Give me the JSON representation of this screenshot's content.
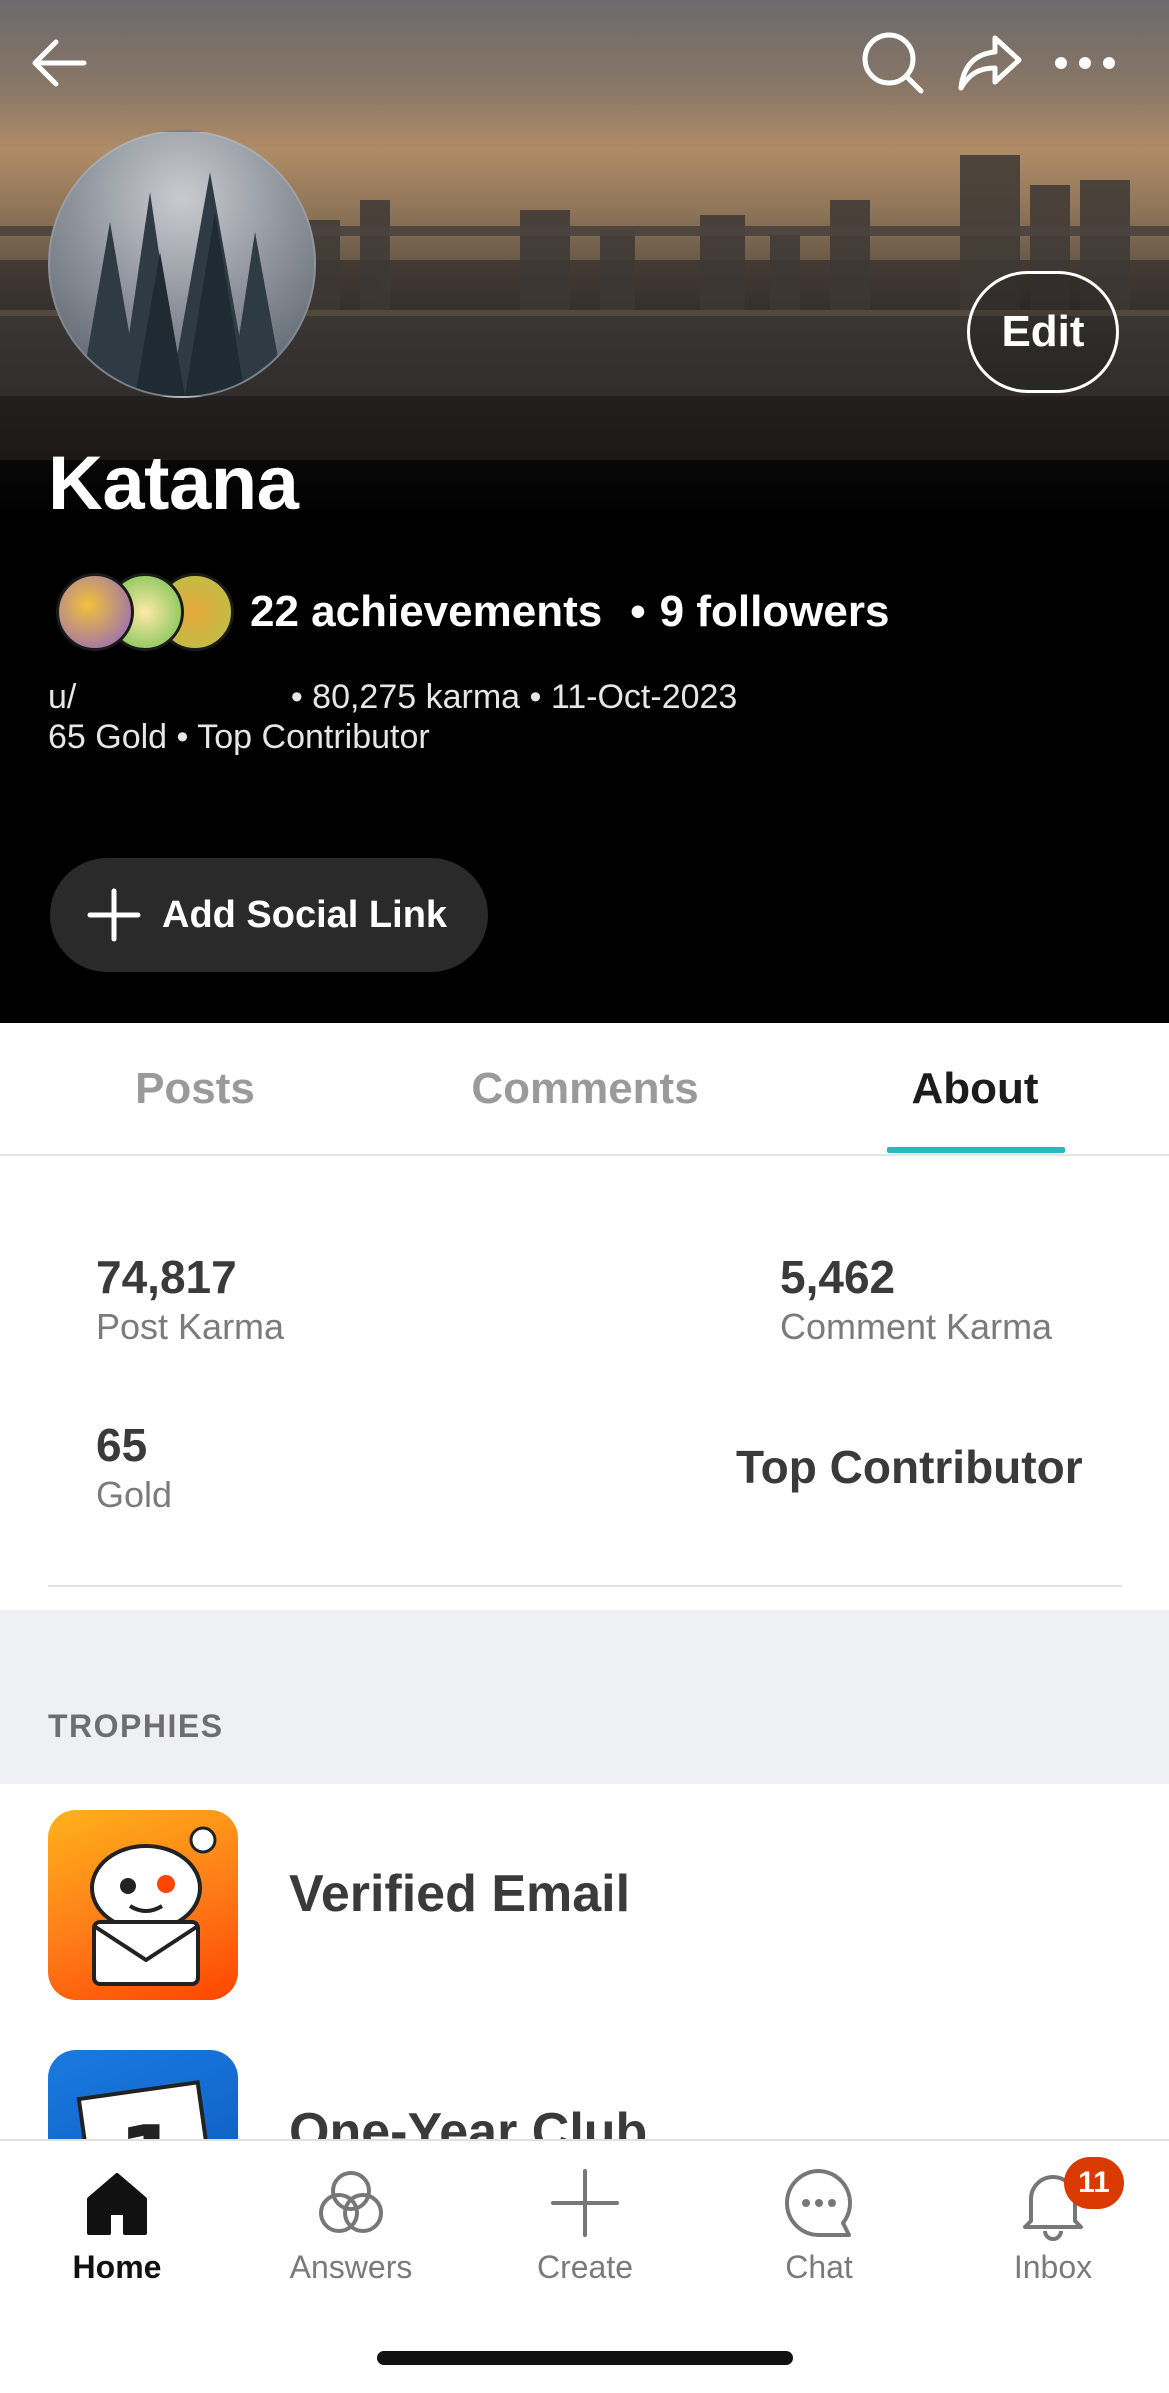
{
  "profile": {
    "display_name": "Katana",
    "achievements": "22 achievements",
    "followers": "9 followers",
    "username_prefix": "u/",
    "karma_line": "• 80,275 karma • 11-Oct-2023",
    "gold_line": "65 Gold • Top Contributor",
    "edit_label": "Edit",
    "social_link_label": "Add Social Link",
    "achievement_badges": [
      "badge-1",
      "badge-2",
      "badge-3"
    ]
  },
  "tabs": [
    {
      "label": "Posts",
      "active": false
    },
    {
      "label": "Comments",
      "active": false
    },
    {
      "label": "About",
      "active": true
    }
  ],
  "about": {
    "post_karma_value": "74,817",
    "post_karma_label": "Post Karma",
    "comment_karma_value": "5,462",
    "comment_karma_label": "Comment Karma",
    "gold_value": "65",
    "gold_label": "Gold",
    "badge_label": "Top Contributor"
  },
  "trophies": {
    "section_title": "TROPHIES",
    "items": [
      {
        "name": "Verified Email",
        "icon": "verified-email-icon"
      },
      {
        "name": "One-Year Club",
        "icon": "one-year-club-icon"
      }
    ]
  },
  "nav": {
    "items": [
      {
        "label": "Home",
        "icon": "home-icon",
        "active": true
      },
      {
        "label": "Answers",
        "icon": "answers-icon",
        "active": false
      },
      {
        "label": "Create",
        "icon": "plus-icon",
        "active": false
      },
      {
        "label": "Chat",
        "icon": "chat-icon",
        "active": false
      },
      {
        "label": "Inbox",
        "icon": "bell-icon",
        "active": false
      }
    ],
    "inbox_badge": "11"
  },
  "colors": {
    "accent": "#28b8c0",
    "notification": "#d93a00"
  }
}
